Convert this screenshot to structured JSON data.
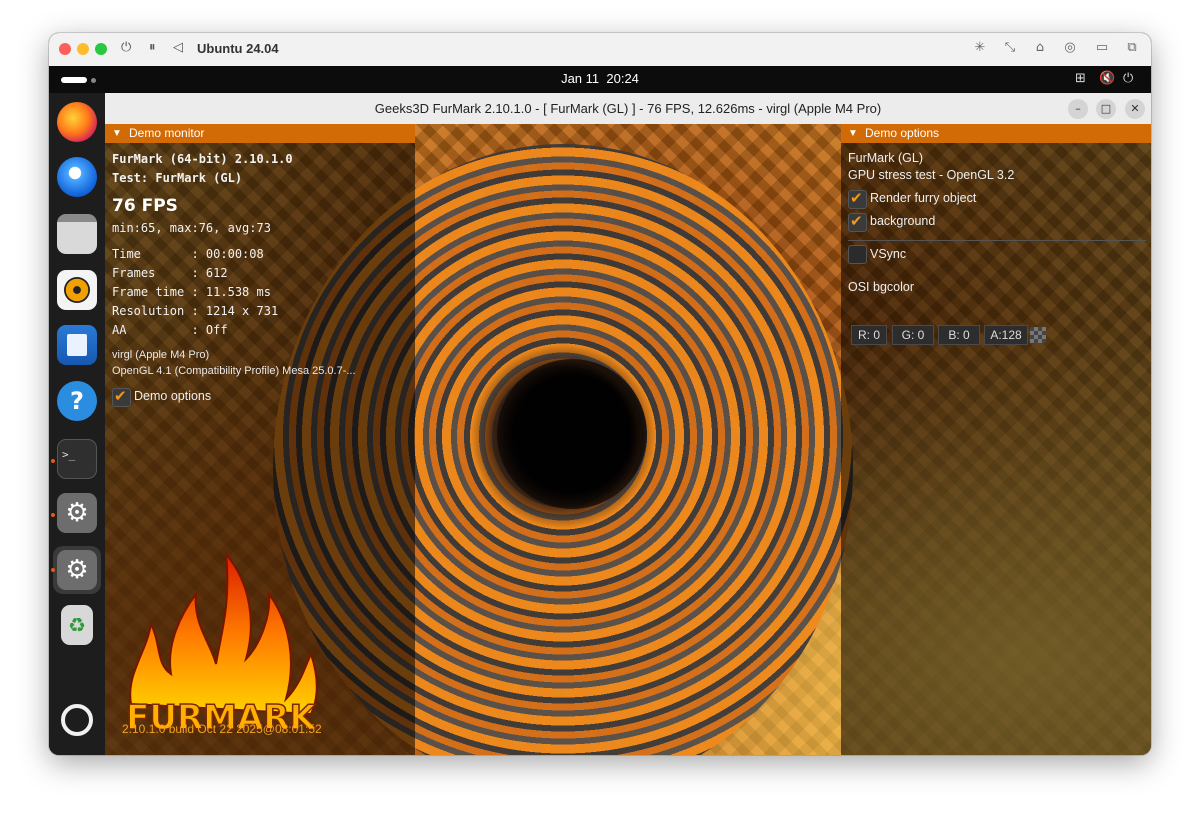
{
  "host": {
    "title": "Ubuntu 24.04",
    "controls": [
      "power-icon",
      "pause-icon",
      "back-icon"
    ],
    "tools": [
      "brightness-icon",
      "resize-icon",
      "usb-icon",
      "network-icon",
      "folder-icon",
      "windows-icon"
    ]
  },
  "topbar": {
    "date": "Jan 11",
    "time": "20:24",
    "status_icons": [
      "network-icon",
      "volume-muted-icon",
      "power-icon"
    ]
  },
  "dock": {
    "items": [
      {
        "name": "firefox-icon"
      },
      {
        "name": "thunderbird-icon"
      },
      {
        "name": "files-icon"
      },
      {
        "name": "rhythmbox-icon"
      },
      {
        "name": "libreoffice-writer-icon"
      },
      {
        "name": "help-icon",
        "glyph": "?"
      },
      {
        "name": "terminal-icon",
        "glyph": ">_"
      },
      {
        "name": "settings-icon",
        "glyph": "⚙"
      },
      {
        "name": "settings-icon-active",
        "glyph": "⚙"
      },
      {
        "name": "trash-icon",
        "glyph": "♻"
      },
      {
        "name": "ubuntu-apps-icon"
      }
    ]
  },
  "app": {
    "title": "Geeks3D FurMark 2.10.1.0 - [ FurMark (GL) ] - 76 FPS, 12.626ms - virgl (Apple M4 Pro)",
    "minimize": "–",
    "maximize": "□",
    "close": "✕"
  },
  "monitor": {
    "header": "Demo monitor",
    "line1": "FurMark (64-bit) 2.10.1.0",
    "line2": "Test: FurMark (GL)",
    "fps": "76 FPS",
    "stats": "min:65, max:76, avg:73",
    "rows": [
      "Time       : 00:00:08",
      "Frames     : 612",
      "Frame time : 11.538 ms",
      "Resolution : 1214 x 731",
      "AA         : Off"
    ],
    "gpu": "virgl (Apple M4 Pro)",
    "gl": "OpenGL 4.1 (Compatibility Profile) Mesa 25.0.7-...",
    "demo_options_label": "Demo options",
    "demo_options_checked": true
  },
  "options": {
    "header": "Demo options",
    "test_name": "FurMark (GL)",
    "test_desc": "GPU stress test - OpenGL 3.2",
    "render_label": "Render furry object",
    "render_checked": true,
    "background_label": "background",
    "background_checked": true,
    "vsync_label": "VSync",
    "vsync_checked": false,
    "osi_label": "OSI bgcolor",
    "r": "R: 0",
    "g": "G: 0",
    "b": "B: 0",
    "a": "A:128"
  },
  "logo": {
    "text": "FURMARK",
    "build": "2.10.1.0 build Oct 22 2025@08:01:52"
  },
  "colors": {
    "accent": "#d26a05",
    "check": "#f29a18",
    "build_text": "#f4a11e"
  }
}
